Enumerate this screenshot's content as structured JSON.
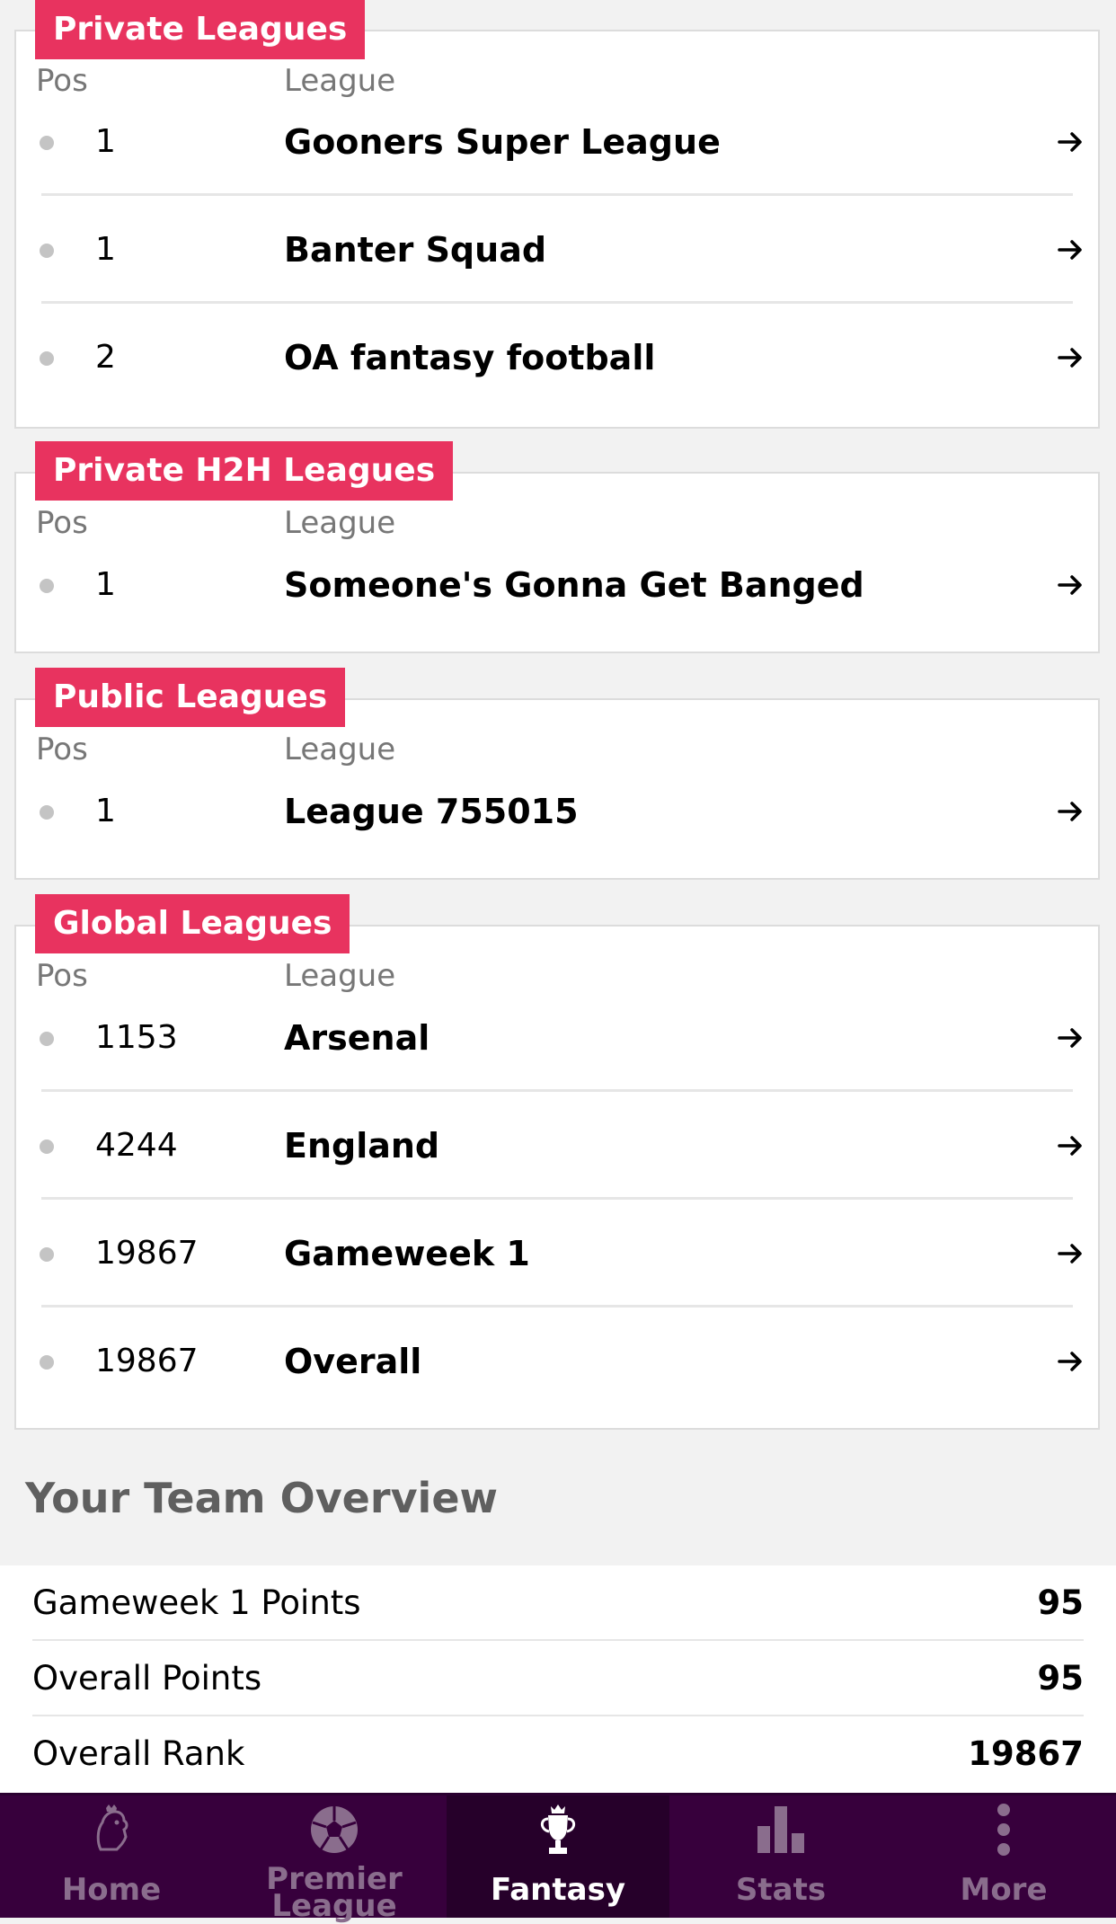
{
  "private_leagues": {
    "title": "Private Leagues",
    "col_pos": "Pos",
    "col_league": "League",
    "rows": [
      {
        "pos": "1",
        "name": "Gooners Super League"
      },
      {
        "pos": "1",
        "name": "Banter Squad"
      },
      {
        "pos": "2",
        "name": "OA fantasy football"
      }
    ]
  },
  "private_h2h_leagues": {
    "title": "Private H2H Leagues",
    "col_pos": "Pos",
    "col_league": "League",
    "rows": [
      {
        "pos": "1",
        "name": "Someone's Gonna Get Banged"
      }
    ]
  },
  "public_leagues": {
    "title": "Public Leagues",
    "col_pos": "Pos",
    "col_league": "League",
    "rows": [
      {
        "pos": "1",
        "name": "League 755015"
      }
    ]
  },
  "global_leagues": {
    "title": "Global Leagues",
    "col_pos": "Pos",
    "col_league": "League",
    "rows": [
      {
        "pos": "1153",
        "name": "Arsenal"
      },
      {
        "pos": "4244",
        "name": "England"
      },
      {
        "pos": "19867",
        "name": "Gameweek 1"
      },
      {
        "pos": "19867",
        "name": "Overall"
      }
    ]
  },
  "overview": {
    "title": "Your Team Overview",
    "rows": [
      {
        "label": "Gameweek 1 Points",
        "value": "95"
      },
      {
        "label": "Overall Points",
        "value": "95"
      },
      {
        "label": "Overall Rank",
        "value": "19867"
      }
    ]
  },
  "nav": {
    "tabs": [
      {
        "label": "Home",
        "icon": "lion-crest-icon"
      },
      {
        "label": "Premier League",
        "label_line1": "Premier",
        "label_line2": "League",
        "icon": "football-icon"
      },
      {
        "label": "Fantasy",
        "icon": "trophy-icon",
        "active": true
      },
      {
        "label": "Stats",
        "icon": "bar-chart-icon"
      },
      {
        "label": "More",
        "icon": "more-vertical-icon"
      }
    ]
  },
  "colors": {
    "accent": "#e8335f",
    "nav_bg": "#37003c",
    "nav_active_bg": "#26002a",
    "nav_inactive_text": "#8a6d8d"
  }
}
